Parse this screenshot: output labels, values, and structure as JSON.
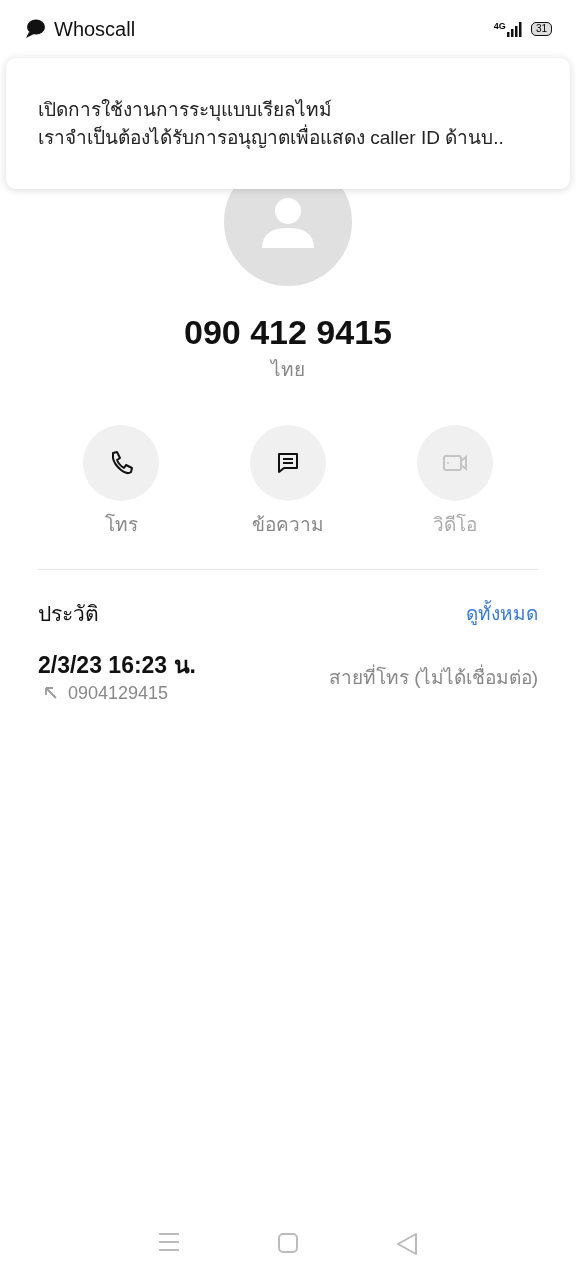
{
  "status_bar": {
    "app_name": "Whoscall",
    "network": "4G",
    "battery": "31"
  },
  "notification": {
    "title": "เปิดการใช้งานการระบุแบบเรียลไทม์",
    "body": "เราจำเป็นต้องได้รับการอนุญาตเพื่อแสดง caller ID ด้านบ.."
  },
  "contact": {
    "number": "090 412 9415",
    "region": "ไทย"
  },
  "actions": [
    {
      "kind": "call",
      "label": "โทร",
      "disabled": false
    },
    {
      "kind": "message",
      "label": "ข้อความ",
      "disabled": false
    },
    {
      "kind": "video",
      "label": "วิดีโอ",
      "disabled": true
    }
  ],
  "history": {
    "title": "ประวัติ",
    "view_all": "ดูทั้งหมด",
    "entries": [
      {
        "time": "2/3/23 16:23 น.",
        "number": "0904129415",
        "kind": "outgoing",
        "status": "สายที่โทร (ไม่ได้เชื่อมต่อ)"
      }
    ]
  }
}
